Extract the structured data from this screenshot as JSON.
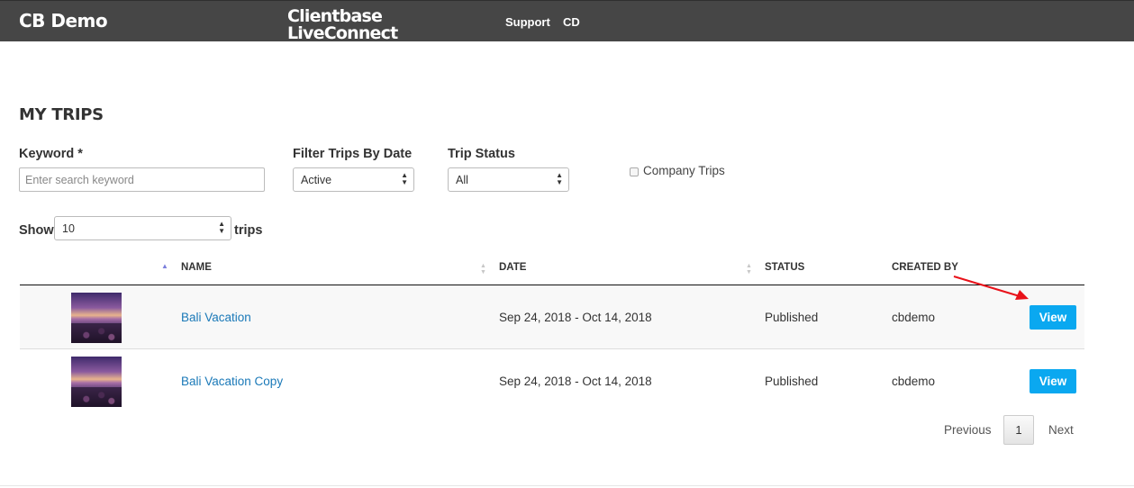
{
  "header": {
    "brand": "CB Demo",
    "product": "Clientbase LiveConnect",
    "nav": {
      "support": "Support",
      "user": "CD"
    }
  },
  "page_title": "MY TRIPS",
  "filters": {
    "keyword_label": "Keyword *",
    "keyword_placeholder": "Enter search keyword",
    "date_label": "Filter Trips By Date",
    "date_value": "Active",
    "status_label": "Trip Status",
    "status_value": "All",
    "company_trips_label": "Company Trips",
    "company_trips_checked": false
  },
  "show": {
    "prefix": "Show",
    "value": "10",
    "suffix": "trips"
  },
  "table": {
    "columns": [
      "NAME",
      "DATE",
      "STATUS",
      "CREATED BY"
    ],
    "rows": [
      {
        "name": "Bali Vacation",
        "date": "Sep 24, 2018 - Oct 14, 2018",
        "status": "Published",
        "created_by": "cbdemo",
        "action": "View"
      },
      {
        "name": "Bali Vacation Copy",
        "date": "Sep 24, 2018 - Oct 14, 2018",
        "status": "Published",
        "created_by": "cbdemo",
        "action": "View"
      }
    ]
  },
  "pagination": {
    "previous": "Previous",
    "current_page": "1",
    "next": "Next"
  },
  "colors": {
    "header_bg": "#464646",
    "link": "#1a79b8",
    "button": "#0aa8f0",
    "annotation_arrow": "#e8121a"
  },
  "icons": [
    "sort-ascending-icon",
    "sort-icon",
    "select-arrows-icon",
    "trip-thumbnail-image",
    "annotation-arrow"
  ]
}
